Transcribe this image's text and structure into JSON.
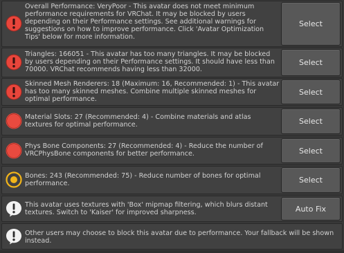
{
  "warnings": [
    {
      "icon": "error-icon",
      "message": "Overall Performance: VeryPoor - This avatar does not meet minimum\nperformance requirements for VRChat. It may be blocked by users\ndepending on their Performance settings. See additional warnings for\nsuggestions on how to improve performance. Click 'Avatar Optimization\nTips' below for more information.",
      "button": "Select"
    },
    {
      "icon": "error-icon",
      "message": "Triangles: 166051 - This avatar has too many triangles. It may be blocked\nby users depending on their Performance settings. It should have less than\n70000. VRChat recommends having less than 32000.",
      "button": "Select"
    },
    {
      "icon": "error-icon",
      "message": "Skinned Mesh Renderers: 18 (Maximum: 16, Recommended: 1) - This avatar\nhas too many skinned meshes. Combine multiple skinned meshes for\noptimal performance.",
      "button": "Select"
    },
    {
      "icon": "poor-icon",
      "message": "Material Slots: 27 (Recommended: 4) - Combine materials and atlas\ntextures for optimal performance.",
      "button": "Select"
    },
    {
      "icon": "poor-icon",
      "message": "Phys Bone Components: 27 (Recommended: 4) - Reduce the number of\nVRCPhysBone components for better performance.",
      "button": "Select"
    },
    {
      "icon": "medium-icon",
      "message": "Bones: 243 (Recommended: 75) - Reduce number of bones for optimal\nperformance.",
      "button": "Select"
    },
    {
      "icon": "info-icon",
      "message": "This avatar uses textures with 'Box' mipmap filtering, which blurs distant\ntextures. Switch to 'Kaiser' for improved sharpness.",
      "button": "Auto Fix"
    },
    {
      "icon": "info-icon",
      "message": "Other users may choose to block this avatar due to performance. Your fallback will be shown\ninstead.",
      "button": ""
    }
  ],
  "colors": {
    "error_red": "#e8453b",
    "poor_red": "#e84a3f",
    "medium_yellow": "#f2b51a",
    "info_white": "#f2f2f2"
  }
}
